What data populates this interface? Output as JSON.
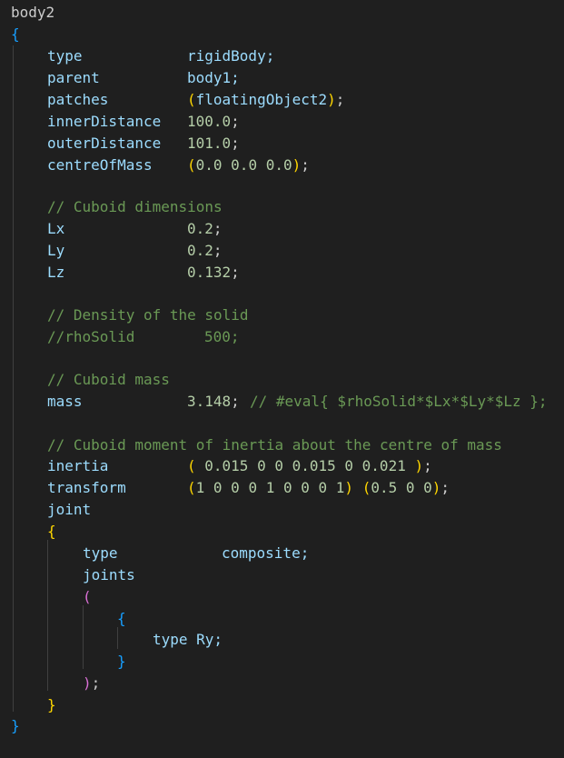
{
  "colors": {
    "background": "#1f1f1f",
    "key": "#9cdcfe",
    "number": "#b5cea8",
    "comment": "#6a9955",
    "punctuation": "#cccccc",
    "bracket_level1": "#ffd700",
    "bracket_level2": "#da70d6",
    "bracket_level3": "#179fff"
  },
  "code": {
    "block_name": "body2",
    "open_brace": "{",
    "close_brace": "}",
    "type": {
      "key": "type",
      "value": "rigidBody;"
    },
    "parent": {
      "key": "parent",
      "value": "body1;"
    },
    "patches": {
      "key": "patches",
      "open": "(",
      "value": "floatingObject2",
      "close": ")",
      "end": ";"
    },
    "innerDistance": {
      "key": "innerDistance",
      "value": "100.0",
      "end": ";"
    },
    "outerDistance": {
      "key": "outerDistance",
      "value": "101.0",
      "end": ";"
    },
    "centreOfMass": {
      "key": "centreOfMass",
      "open": "(",
      "value": "0.0 0.0 0.0",
      "close": ")",
      "end": ";"
    },
    "comment_dimensions": "// Cuboid dimensions",
    "Lx": {
      "key": "Lx",
      "value": "0.2",
      "end": ";"
    },
    "Ly": {
      "key": "Ly",
      "value": "0.2",
      "end": ";"
    },
    "Lz": {
      "key": "Lz",
      "value": "0.132",
      "end": ";"
    },
    "comment_density": "// Density of the solid",
    "rhoSolid_comment": {
      "key": "//rhoSolid",
      "value": "500;"
    },
    "comment_mass": "// Cuboid mass",
    "mass": {
      "key": "mass",
      "value": "3.148",
      "end": ";",
      "comment": "// #eval{ $rhoSolid*$Lx*$Ly*$Lz };"
    },
    "comment_inertia": "// Cuboid moment of inertia about the centre of mass",
    "inertia": {
      "key": "inertia",
      "open": "(",
      "value": " 0.015 0 0 0.015 0 0.021 ",
      "close": ")",
      "end": ";"
    },
    "transform": {
      "key": "transform",
      "open1": "(",
      "value1": "1 0 0 0 1 0 0 0 1",
      "close1": ")",
      "open2": "(",
      "value2": "0.5 0 0",
      "close2": ")",
      "end": ";"
    },
    "joint": {
      "key": "joint",
      "open_brace": "{",
      "close_brace": "}",
      "type": {
        "key": "type",
        "value": "composite;"
      },
      "joints": {
        "key": "joints",
        "open_paren": "(",
        "close_paren": ")",
        "end": ";",
        "item": {
          "open_brace": "{",
          "close_brace": "}",
          "text": "type Ry;"
        }
      }
    }
  }
}
